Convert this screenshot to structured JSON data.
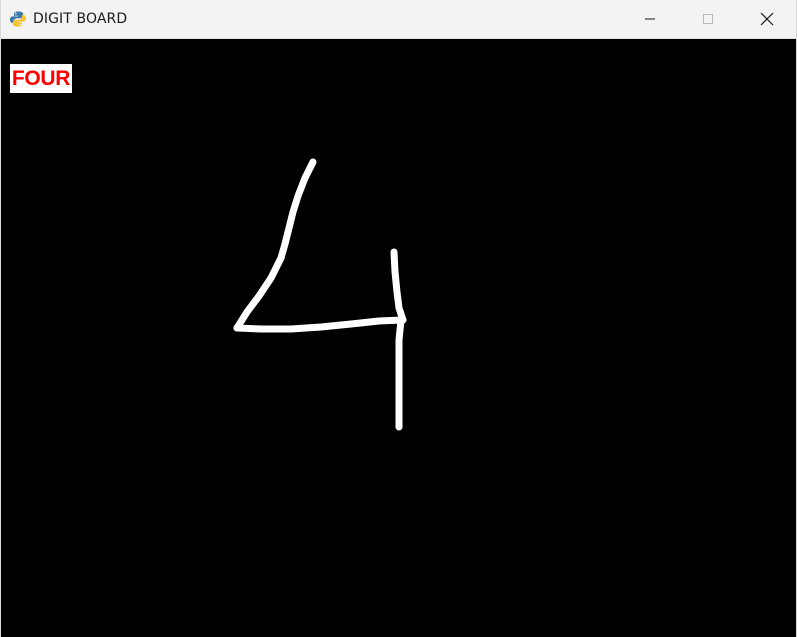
{
  "window": {
    "title": "DIGIT BOARD",
    "app_icon": "python-icon",
    "controls": {
      "minimize_icon": "minimize-icon",
      "maximize_icon": "maximize-icon",
      "close_icon": "close-icon"
    }
  },
  "board": {
    "background_color": "#000000",
    "stroke_color": "#ffffff",
    "prediction_label": "FOUR",
    "prediction_label_color": "#ff0000",
    "prediction_label_background": "#ffffff"
  }
}
